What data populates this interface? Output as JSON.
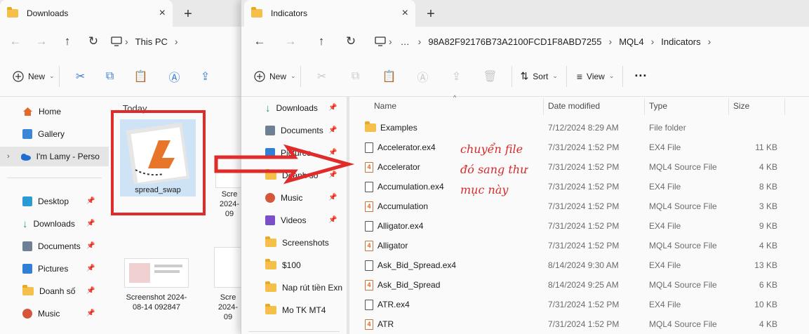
{
  "win1": {
    "tab_title": "Downloads",
    "crumbs": [
      "This PC"
    ],
    "toolbar": {
      "new_label": "New"
    },
    "nav": [
      {
        "label": "Home",
        "icon": "home-icon",
        "pinned": false
      },
      {
        "label": "Gallery",
        "icon": "gallery-icon",
        "pinned": false
      },
      {
        "label": "I'm Lamy - Perso",
        "icon": "onedrive-cloud-icon",
        "pinned": false
      },
      {
        "label": "Desktop",
        "icon": "desktop-icon",
        "pinned": true
      },
      {
        "label": "Downloads",
        "icon": "download-icon",
        "pinned": true
      },
      {
        "label": "Documents",
        "icon": "documents-icon",
        "pinned": true
      },
      {
        "label": "Pictures",
        "icon": "pictures-icon",
        "pinned": true
      },
      {
        "label": "Doanh số",
        "icon": "folder-icon",
        "pinned": true
      },
      {
        "label": "Music",
        "icon": "music-icon",
        "pinned": true
      }
    ],
    "group_header": "Today",
    "items": [
      {
        "label": "spread_swap",
        "icon": "mql4-file-icon"
      },
      {
        "label": "Scre 2024- 09",
        "icon": "screenshot-thumbnail"
      },
      {
        "label": "Screenshot 2024-08-14 092847",
        "icon": "screenshot-thumbnail"
      },
      {
        "label": "Scre 2024- 09",
        "icon": "screenshot-thumbnail"
      }
    ]
  },
  "win2": {
    "tab_title": "Indicators",
    "crumbs": [
      "98A82F92176B73A2100FCD1F8ABD7255",
      "MQL4",
      "Indicators"
    ],
    "toolbar": {
      "new_label": "New",
      "sort_label": "Sort",
      "view_label": "View"
    },
    "nav": [
      {
        "label": "Downloads",
        "icon": "download-icon",
        "pinned": true
      },
      {
        "label": "Documents",
        "icon": "documents-icon",
        "pinned": true
      },
      {
        "label": "Pictures",
        "icon": "pictures-icon",
        "pinned": true
      },
      {
        "label": "Doanh số",
        "icon": "folder-icon",
        "pinned": true
      },
      {
        "label": "Music",
        "icon": "music-icon",
        "pinned": true
      },
      {
        "label": "Videos",
        "icon": "videos-icon",
        "pinned": true
      },
      {
        "label": "Screenshots",
        "icon": "folder-icon",
        "pinned": false
      },
      {
        "label": "$100",
        "icon": "folder-icon",
        "pinned": false
      },
      {
        "label": "Nap rút tiền Exn",
        "icon": "folder-icon",
        "pinned": false
      },
      {
        "label": "Mo TK MT4",
        "icon": "folder-icon",
        "pinned": false
      }
    ],
    "columns": [
      "Name",
      "Date modified",
      "Type",
      "Size"
    ],
    "files": [
      {
        "name": "Examples",
        "date": "7/12/2024 8:29 AM",
        "type": "File folder",
        "size": "",
        "kind": "folder"
      },
      {
        "name": "Accelerator.ex4",
        "date": "7/31/2024 1:52 PM",
        "type": "EX4 File",
        "size": "11 KB",
        "kind": "ex4"
      },
      {
        "name": "Accelerator",
        "date": "7/31/2024 1:52 PM",
        "type": "MQL4 Source File",
        "size": "4 KB",
        "kind": "mq4"
      },
      {
        "name": "Accumulation.ex4",
        "date": "7/31/2024 1:52 PM",
        "type": "EX4 File",
        "size": "8 KB",
        "kind": "ex4"
      },
      {
        "name": "Accumulation",
        "date": "7/31/2024 1:52 PM",
        "type": "MQL4 Source File",
        "size": "3 KB",
        "kind": "mq4"
      },
      {
        "name": "Alligator.ex4",
        "date": "7/31/2024 1:52 PM",
        "type": "EX4 File",
        "size": "9 KB",
        "kind": "ex4"
      },
      {
        "name": "Alligator",
        "date": "7/31/2024 1:52 PM",
        "type": "MQL4 Source File",
        "size": "4 KB",
        "kind": "mq4"
      },
      {
        "name": "Ask_Bid_Spread.ex4",
        "date": "8/14/2024 9:30 AM",
        "type": "EX4 File",
        "size": "13 KB",
        "kind": "ex4"
      },
      {
        "name": "Ask_Bid_Spread",
        "date": "8/14/2024 9:25 AM",
        "type": "MQL4 Source File",
        "size": "6 KB",
        "kind": "mq4"
      },
      {
        "name": "ATR.ex4",
        "date": "7/31/2024 1:52 PM",
        "type": "EX4 File",
        "size": "10 KB",
        "kind": "ex4"
      },
      {
        "name": "ATR",
        "date": "7/31/2024 1:52 PM",
        "type": "MQL4 Source File",
        "size": "4 KB",
        "kind": "mq4"
      }
    ]
  },
  "annotation": {
    "text": "chuyển file đó sang thư mục này",
    "lines": [
      "chuyển file",
      "đó sang thư",
      "mục này"
    ],
    "color": "#d62a2a"
  },
  "colors": {
    "accent": "#3a7bd5",
    "highlight_red": "#e02b2b",
    "folder": "#f4c04a"
  }
}
